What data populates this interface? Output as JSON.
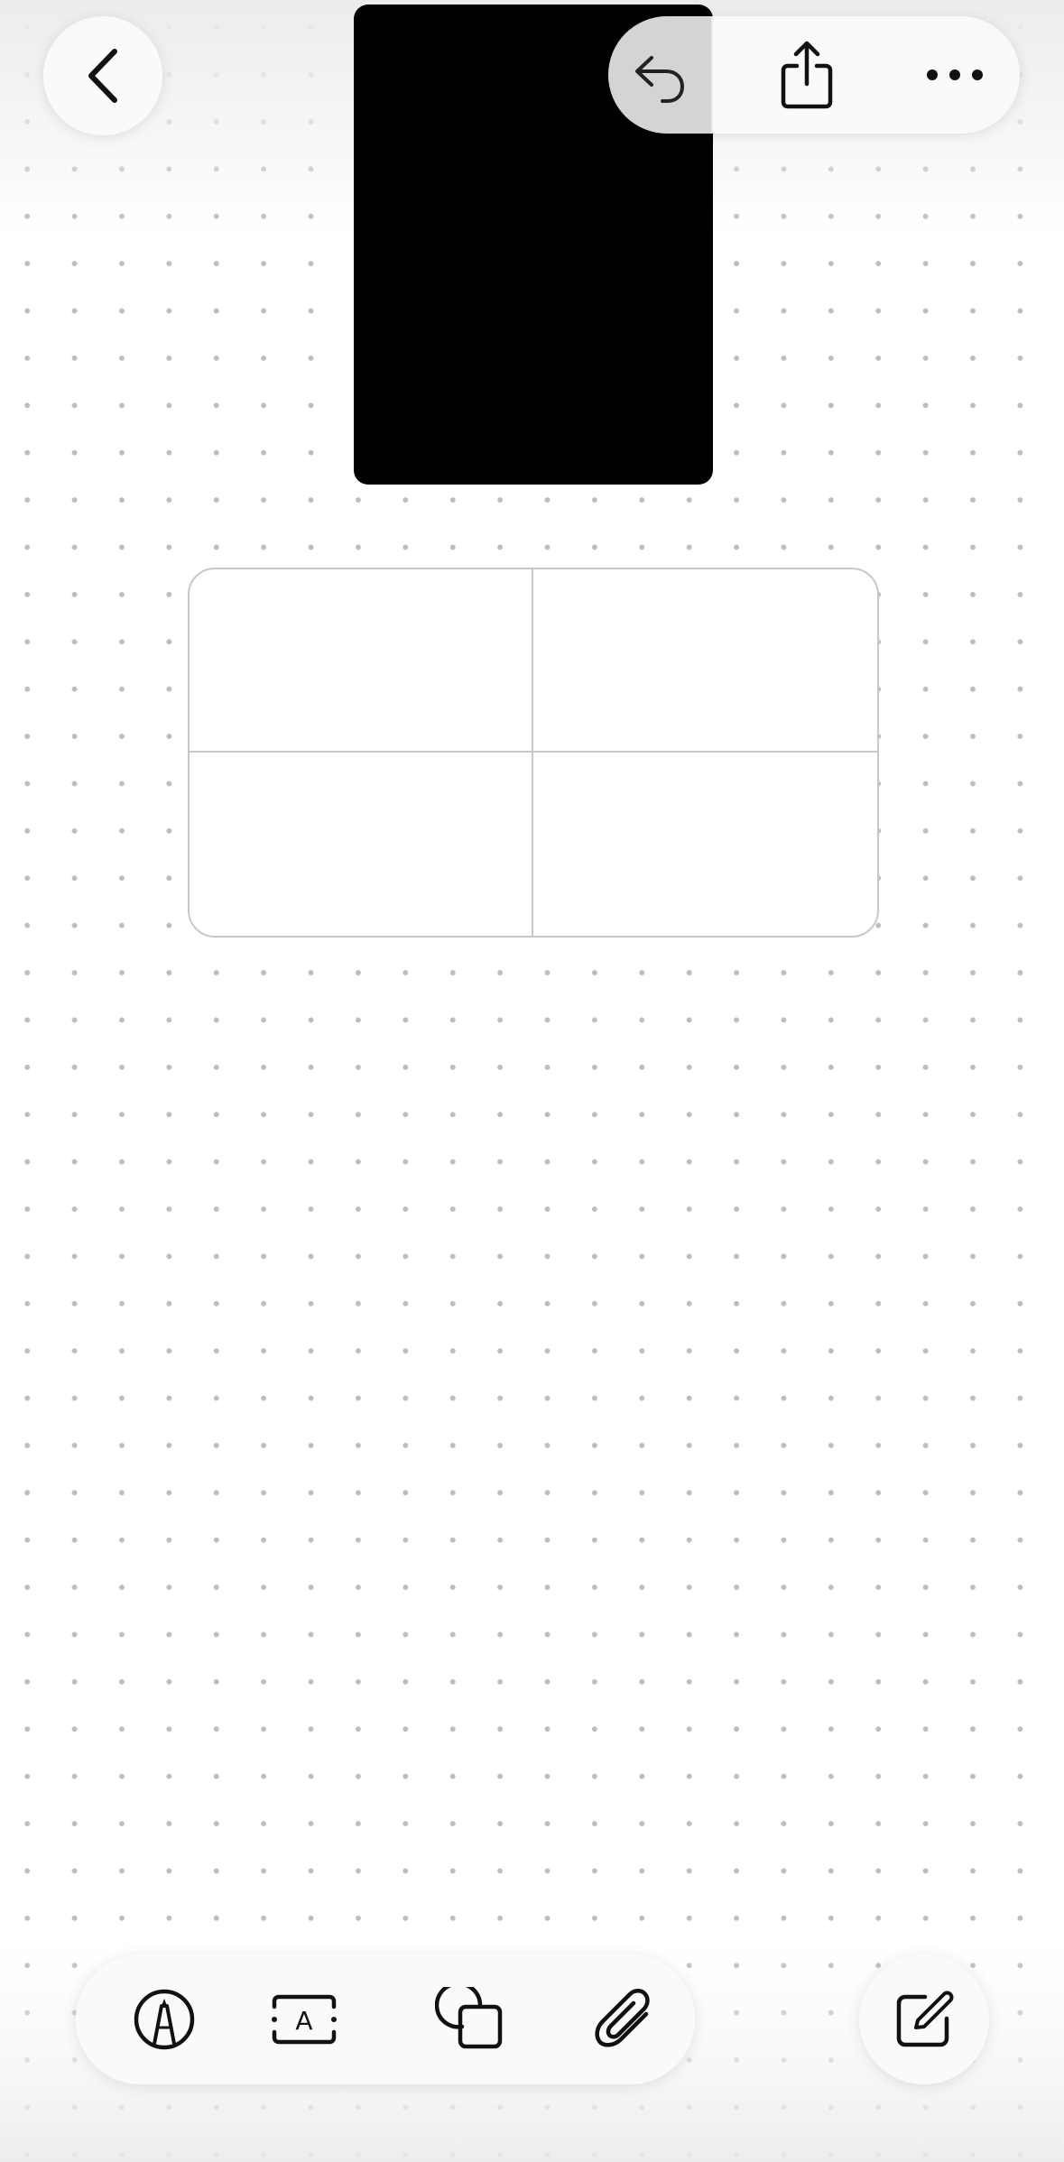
{
  "canvas": {
    "background": "#ffffff",
    "dot_color": "#bdbdbd"
  },
  "top_bar": {
    "back_icon": "chevron-left-icon",
    "actions": [
      {
        "id": "undo",
        "icon": "undo-arrow-icon",
        "state": "highlighted"
      },
      {
        "id": "share",
        "icon": "share-icon"
      },
      {
        "id": "more",
        "icon": "ellipsis-icon"
      }
    ]
  },
  "media": {
    "color": "#000000"
  },
  "table": {
    "rows": 2,
    "columns": 2,
    "cells": [
      "",
      "",
      "",
      ""
    ]
  },
  "bottom_toolbar": {
    "tools": [
      {
        "id": "pen",
        "icon": "pen-tip-icon"
      },
      {
        "id": "text",
        "icon": "text-box-icon",
        "glyph": "A"
      },
      {
        "id": "shapes",
        "icon": "shapes-icon"
      },
      {
        "id": "attach",
        "icon": "paperclip-icon"
      }
    ],
    "compose_icon": "compose-icon"
  }
}
